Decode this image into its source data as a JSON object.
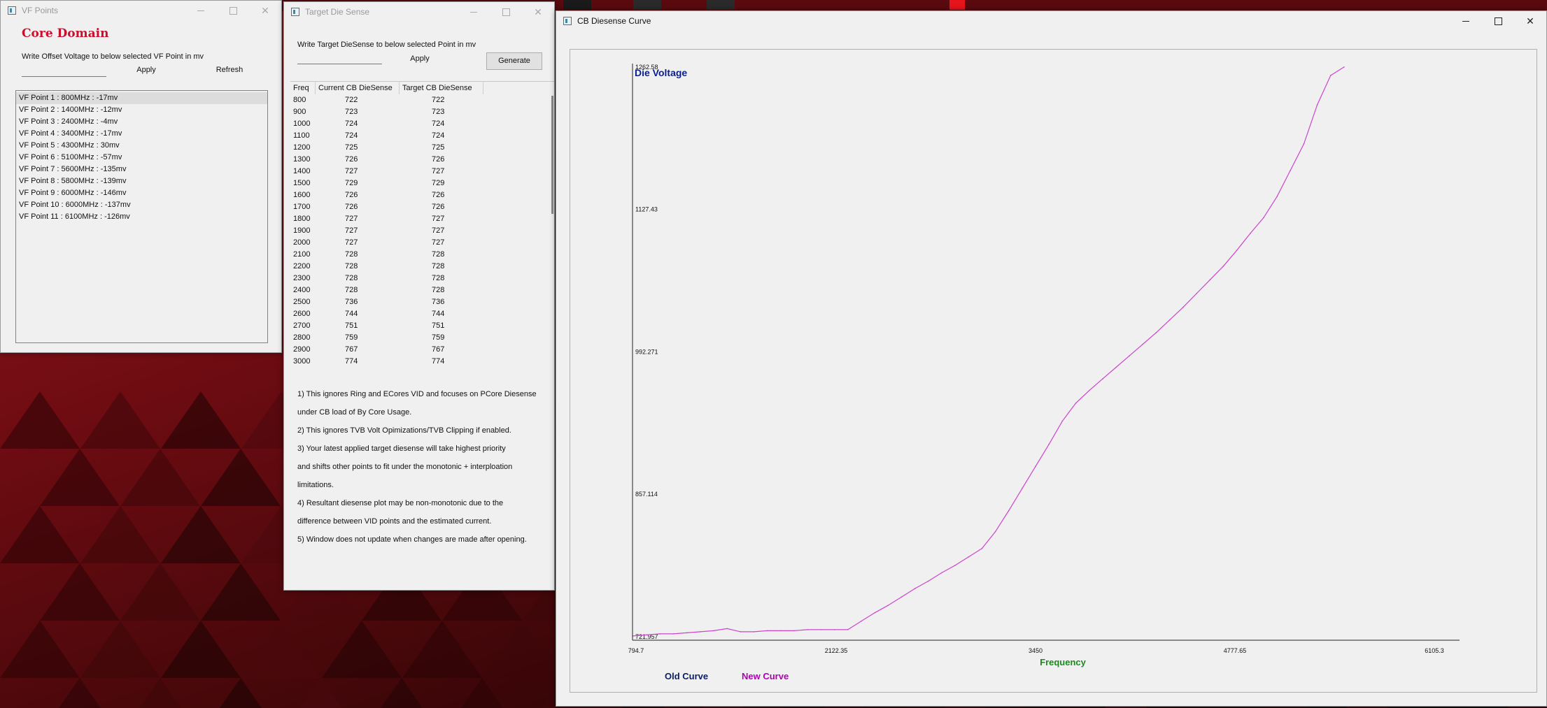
{
  "vf_window": {
    "title": "VF Points",
    "heading": "Core Domain",
    "instruction": "Write Offset Voltage to below selected VF Point in mv",
    "input_value": "",
    "apply_label": "Apply",
    "refresh_label": "Refresh",
    "items": [
      "VF Point 1 : 800MHz : -17mv",
      "VF Point 2 : 1400MHz : -12mv",
      "VF Point 3 : 2400MHz : -4mv",
      "VF Point 4 : 3400MHz : -17mv",
      "VF Point 5 : 4300MHz : 30mv",
      "VF Point 6 : 5100MHz : -57mv",
      "VF Point 7 : 5600MHz : -135mv",
      "VF Point 8 : 5800MHz : -139mv",
      "VF Point 9 : 6000MHz : -146mv",
      "VF Point 10 : 6000MHz : -137mv",
      "VF Point 11 : 6100MHz : -126mv"
    ],
    "selected_index": 0
  },
  "tds_window": {
    "title": "Target Die Sense",
    "instruction": "Write Target DieSense to below selected Point in mv",
    "input_value": "",
    "apply_label": "Apply",
    "generate_label": "Generate",
    "columns": [
      "Freq",
      "Current CB DieSense",
      "Target CB DieSense"
    ],
    "rows": [
      [
        "800",
        "722",
        "722"
      ],
      [
        "900",
        "723",
        "723"
      ],
      [
        "1000",
        "724",
        "724"
      ],
      [
        "1100",
        "724",
        "724"
      ],
      [
        "1200",
        "725",
        "725"
      ],
      [
        "1300",
        "726",
        "726"
      ],
      [
        "1400",
        "727",
        "727"
      ],
      [
        "1500",
        "729",
        "729"
      ],
      [
        "1600",
        "726",
        "726"
      ],
      [
        "1700",
        "726",
        "726"
      ],
      [
        "1800",
        "727",
        "727"
      ],
      [
        "1900",
        "727",
        "727"
      ],
      [
        "2000",
        "727",
        "727"
      ],
      [
        "2100",
        "728",
        "728"
      ],
      [
        "2200",
        "728",
        "728"
      ],
      [
        "2300",
        "728",
        "728"
      ],
      [
        "2400",
        "728",
        "728"
      ],
      [
        "2500",
        "736",
        "736"
      ],
      [
        "2600",
        "744",
        "744"
      ],
      [
        "2700",
        "751",
        "751"
      ],
      [
        "2800",
        "759",
        "759"
      ],
      [
        "2900",
        "767",
        "767"
      ],
      [
        "3000",
        "774",
        "774"
      ]
    ],
    "notes": [
      "1) This ignores Ring and ECores VID and focuses on PCore Diesense",
      "under CB load of By Core Usage.",
      "2) This ignores TVB Volt Opimizations/TVB Clipping if enabled.",
      "3) Your latest applied target diesense will take highest priority",
      "and shifts other points to fit under the monotonic + interploation",
      "limitations.",
      "4) Resultant diesense plot may be non-monotonic due to the",
      "difference between VID points and the estimated current.",
      "5) Window does not update when changes are made after opening."
    ]
  },
  "curve_window": {
    "title": "CB Diesense Curve"
  },
  "chart_data": {
    "type": "line",
    "title": "Die Voltage",
    "xlabel": "Frequency",
    "ylabel": "Die Voltage",
    "xlim": [
      794.7,
      6105.3
    ],
    "ylim": [
      721.957,
      1262.58
    ],
    "x_ticks": [
      "794.7",
      "2122.35",
      "3450",
      "4777.65",
      "6105.3"
    ],
    "y_ticks": [
      "1262.58",
      "1127.43",
      "992.271",
      "857.114",
      "721.957"
    ],
    "grid": false,
    "legend": [
      "Old Curve",
      "New Curve"
    ],
    "series": [
      {
        "name": "New Curve",
        "x": [
          800,
          900,
          1000,
          1100,
          1200,
          1300,
          1400,
          1500,
          1600,
          1700,
          1800,
          1900,
          2000,
          2100,
          2200,
          2300,
          2400,
          2500,
          2600,
          2700,
          2800,
          2900,
          3000,
          3100,
          3200,
          3300,
          3400,
          3500,
          3600,
          3700,
          3800,
          3900,
          4000,
          4100,
          4200,
          4300,
          4400,
          4500,
          4600,
          4700,
          4800,
          4900,
          5000,
          5100,
          5200,
          5300,
          5400,
          5500,
          5600,
          5700,
          5800,
          5900,
          6000,
          6100
        ],
        "values": [
          722,
          723,
          724,
          724,
          725,
          726,
          727,
          729,
          726,
          726,
          727,
          727,
          727,
          728,
          728,
          728,
          728,
          736,
          744,
          751,
          759,
          767,
          774,
          782,
          789,
          797,
          805,
          821,
          841,
          862,
          883,
          904,
          926,
          943,
          955,
          966,
          977,
          988,
          999,
          1010,
          1022,
          1034,
          1047,
          1060,
          1073,
          1088,
          1104,
          1119,
          1139,
          1164,
          1189,
          1226,
          1254,
          1262
        ]
      }
    ]
  },
  "colors": {
    "vf_heading": "#c8102e",
    "chart_title": "#0a1e8c",
    "xlabel": "#1a8a1a",
    "old_curve": "#0a1e64",
    "new_curve": "#b000b8",
    "line": "#cc44cc"
  }
}
